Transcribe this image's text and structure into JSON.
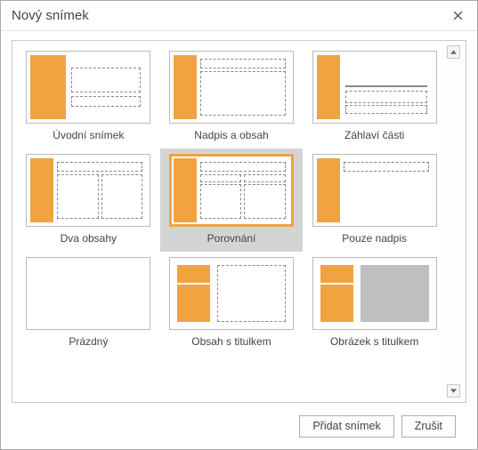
{
  "dialog": {
    "title": "Nový snímek"
  },
  "layouts": [
    {
      "label": "Úvodní snímek"
    },
    {
      "label": "Nadpis a obsah"
    },
    {
      "label": "Záhlaví části"
    },
    {
      "label": "Dva obsahy"
    },
    {
      "label": "Porovnání"
    },
    {
      "label": "Pouze nadpis"
    },
    {
      "label": "Prázdný"
    },
    {
      "label": "Obsah s titulkem"
    },
    {
      "label": "Obrázek s titulkem"
    }
  ],
  "selected_index": 4,
  "buttons": {
    "add": "Přidat snímek",
    "cancel": "Zrušit"
  }
}
